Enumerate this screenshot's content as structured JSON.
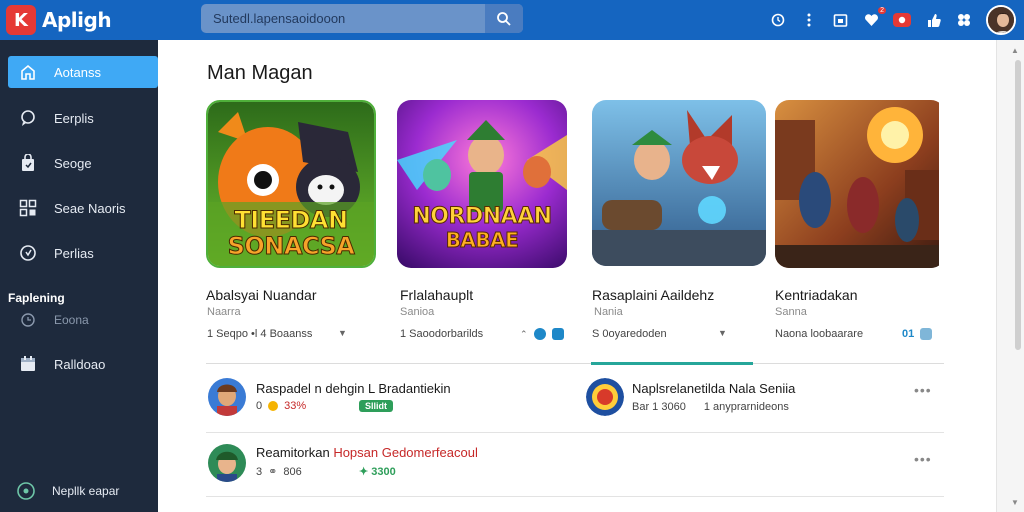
{
  "app": {
    "logo_letter": "K",
    "name": "Apligh"
  },
  "search": {
    "placeholder": "Sutedl.lapensaoidooon"
  },
  "topbar": {
    "notification_count": "2"
  },
  "sidebar": {
    "items": [
      {
        "label": "Aotanss",
        "icon": "home-icon",
        "active": true
      },
      {
        "label": "Eerplis",
        "icon": "chat-icon"
      },
      {
        "label": "Seoge",
        "icon": "bag-icon"
      },
      {
        "label": "Seae Naoris",
        "icon": "grid-icon"
      },
      {
        "label": "Perlias",
        "icon": "info-icon"
      }
    ],
    "section_heading": "Faplening",
    "section_item": "Eoona",
    "item_after_section": "Ralldoao",
    "footer": "Nepllk eapar"
  },
  "main": {
    "title": "Man Magan",
    "cards": [
      {
        "art_line1": "TIEEDAN",
        "art_line2": "SONACSA",
        "title": "Abalsyai Nuandar",
        "subtitle": "Naarra",
        "meta": "1 Seqpo •l 4 Boaanss"
      },
      {
        "art_line1": "NORDNAAN",
        "art_line2": "BABAE",
        "title": "Frlalahauplt",
        "subtitle": "Sanioa",
        "meta": "1 Saoodorbarilds"
      },
      {
        "art_line1": "",
        "art_line2": "",
        "title": "Rasaplaini Aaildehz",
        "subtitle": "Nania",
        "meta": "S 0oyaredoden"
      },
      {
        "art_line1": "",
        "art_line2": "",
        "title": "Kentriadakan",
        "subtitle": "Sanna",
        "meta": "Naona loobaarare",
        "meta_badge": "01"
      }
    ],
    "list": [
      {
        "title": "Raspadel n dehgin L Bradantiekin",
        "accent": "",
        "meta_num": "0",
        "meta_pct": "33%",
        "badge": "Sllidt"
      },
      {
        "title": "Naplsrelanetilda Nala Seniia",
        "accent": "",
        "meta_a": "Bar 1 3060",
        "meta_b": "1 anyprarnideons"
      },
      {
        "title": "Reamitorkan ",
        "accent": "Hopsan Gedomerfeacoul",
        "meta_num": "3",
        "meta_pct": "806",
        "green_text": "3300"
      }
    ]
  },
  "colors": {
    "topbar": "#1565c0",
    "sidebar": "#1e2a3d",
    "active": "#3fa9f5",
    "tab_accent": "#26a69a"
  }
}
